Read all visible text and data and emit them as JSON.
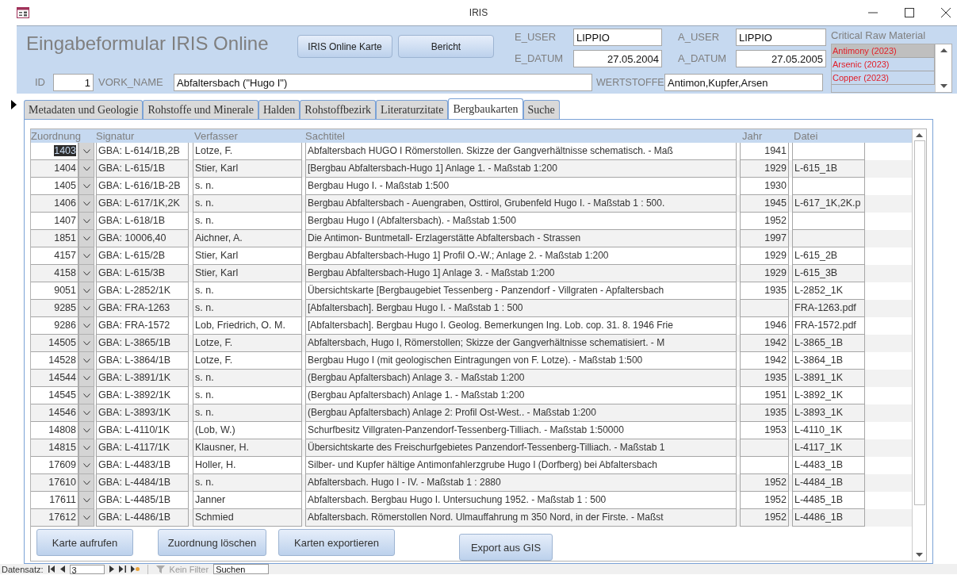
{
  "window": {
    "title": "IRIS"
  },
  "header": {
    "title": "Eingabeformular IRIS Online",
    "buttons": [
      "IRIS Online Karte",
      "Bericht"
    ],
    "fields": [
      {
        "label": "E_USER",
        "value": "LIPPIO",
        "kind": "text"
      },
      {
        "label": "A_USER",
        "value": "LIPPIO",
        "kind": "text"
      },
      {
        "label": "E_DATUM",
        "value": "27.05.2004",
        "kind": "date"
      },
      {
        "label": "A_DATUM",
        "value": "27.05.2005",
        "kind": "date"
      }
    ]
  },
  "record": {
    "id": {
      "label": "ID",
      "value": "1"
    },
    "vork_name": {
      "label": "VORK_NAME",
      "value": "Abfaltersbach (\"Hugo I\")"
    },
    "wertstoffe": {
      "label": "WERTSTOFFE",
      "value": "Antimon,Kupfer,Arsen"
    }
  },
  "critical_raw_material": {
    "label": "Critical Raw Material",
    "items": [
      {
        "name": "Antimony (2023)",
        "selected": true
      },
      {
        "name": "Arsenic (2023)",
        "selected": false
      },
      {
        "name": "Copper (2023)",
        "selected": false
      }
    ]
  },
  "tabs": [
    {
      "label": "Metadaten und Geologie",
      "selected": false
    },
    {
      "label": "Rohstoffe und Minerale",
      "selected": false
    },
    {
      "label": "Halden",
      "selected": false
    },
    {
      "label": "Rohstoffbezirk",
      "selected": false
    },
    {
      "label": "Literaturzitate",
      "selected": false
    },
    {
      "label": "Bergbaukarten",
      "selected": true
    },
    {
      "label": "Suche",
      "selected": false
    }
  ],
  "grid": {
    "columns": [
      "Zuordnung",
      "Signatur",
      "Verfasser",
      "Sachtitel",
      "Jahr",
      "Datei"
    ],
    "rows": [
      {
        "zuordnung": "1403",
        "signatur": "GBA: L-614/1B,2B",
        "verfasser": "Lotze, F.",
        "sachtitel": "Abfaltersbach HUGO I Römerstollen. Skizze der Gangverhältnisse schematisch. - Maß",
        "jahr": "1941",
        "selected": true
      },
      {
        "zuordnung": "1404",
        "signatur": "GBA: L-615/1B",
        "verfasser": "Stier, Karl",
        "sachtitel": "[Bergbau Abfaltersbach-Hugo 1] Anlage 1. - Maßstab 1:200",
        "jahr": "1929",
        "datei": "L-615_1B",
        "selected": false
      },
      {
        "zuordnung": "1405",
        "signatur": "GBA: L-616/1B-2B",
        "verfasser": "s. n.",
        "sachtitel": "Bergbau Hugo I. - Maßstab 1:500",
        "jahr": "1930",
        "selected": false
      },
      {
        "zuordnung": "1406",
        "signatur": "GBA: L-617/1K,2K",
        "verfasser": "s. n.",
        "sachtitel": "Bergbau Abfaltersbach - Auengraben, Osttirol, Grubenfeld Hugo I. - Maßstab 1 : 500.",
        "jahr": "1945",
        "datei": "L-617_1K,2K.p",
        "selected": false
      },
      {
        "zuordnung": "1407",
        "signatur": "GBA: L-618/1B",
        "verfasser": "s. n.",
        "sachtitel": "Bergbau Hugo I (Abfaltersbach). - Maßstab 1:500",
        "jahr": "1952",
        "selected": false
      },
      {
        "zuordnung": "1851",
        "signatur": "GBA: 10006,40",
        "verfasser": "Aichner, A.",
        "sachtitel": "Die Antimon- Buntmetall- Erzlagerstätte Abfaltersbach - Strassen",
        "jahr": "1997",
        "selected": false
      },
      {
        "zuordnung": "4157",
        "signatur": "GBA: L-615/2B",
        "verfasser": "Stier, Karl",
        "sachtitel": "Bergbau Abfaltersbach-Hugo 1] Profil O.-W.; Anlage 2. - Maßstab 1:200",
        "jahr": "1929",
        "datei": "L-615_2B",
        "selected": false
      },
      {
        "zuordnung": "4158",
        "signatur": "GBA: L-615/3B",
        "verfasser": "Stier, Karl",
        "sachtitel": "Bergbau Abfaltersbach-Hugo 1] Anlage 3. - Maßstab 1:200",
        "jahr": "1929",
        "datei": "L-615_3B",
        "selected": false
      },
      {
        "zuordnung": "9051",
        "signatur": "GBA: L-2852/1K",
        "verfasser": "s. n.",
        "sachtitel": "Übersichtskarte [Bergbaugebiet Tessenberg - Panzendorf - Villgraten - Apfaltersbach",
        "jahr": "1935",
        "datei": "L-2852_1K",
        "selected": false
      },
      {
        "zuordnung": "9285",
        "signatur": "GBA: FRA-1263",
        "verfasser": "s. n.",
        "sachtitel": "[Abfaltersbach]. Bergbau Hugo I. - Maßstab 1 : 500",
        "datei": "FRA-1263.pdf",
        "selected": false
      },
      {
        "zuordnung": "9286",
        "signatur": "GBA: FRA-1572",
        "verfasser": "Lob, Friedrich, O. M.",
        "sachtitel": "[Abfaltersbach]. Bergbau Hugo I. Geolog. Bemerkungen Ing. Lob. cop. 31. 8. 1946 Frie",
        "jahr": "1946",
        "datei": "FRA-1572.pdf",
        "selected": false
      },
      {
        "zuordnung": "14505",
        "signatur": "GBA: L-3865/1B",
        "verfasser": "Lotze, F.",
        "sachtitel": "Abfaltersbach, Hugo I, Römerstollen; Skizze der Gangverhältnisse schematisiert. - M",
        "jahr": "1942",
        "datei": "L-3865_1B",
        "selected": false
      },
      {
        "zuordnung": "14528",
        "signatur": "GBA: L-3864/1B",
        "verfasser": "Lotze, F.",
        "sachtitel": "Bergbau Hugo I (mit geologischen Eintragungen von F. Lotze). - Maßstab 1:500",
        "jahr": "1942",
        "datei": "L-3864_1B",
        "selected": false
      },
      {
        "zuordnung": "14544",
        "signatur": "GBA: L-3891/1K",
        "verfasser": "s. n.",
        "sachtitel": "(Bergbau Apfaltersbach) Anlage 3. - Maßstab 1:200",
        "jahr": "1935",
        "datei": "L-3891_1K",
        "selected": false
      },
      {
        "zuordnung": "14545",
        "signatur": "GBA: L-3892/1K",
        "verfasser": "s. n.",
        "sachtitel": "(Bergbau Apfaltersbach) Anlage 1. - Maßstab 1:200",
        "jahr": "1951",
        "datei": "L-3892_1K",
        "selected": false
      },
      {
        "zuordnung": "14546",
        "signatur": "GBA: L-3893/1K",
        "verfasser": "s. n.",
        "sachtitel": "(Bergbau Apfaltersbach) Anlage 2: Profil Ost-West.. - Maßstab 1:200",
        "jahr": "1935",
        "datei": "L-3893_1K",
        "selected": false
      },
      {
        "zuordnung": "14808",
        "signatur": "GBA: L-4110/1K",
        "verfasser": "(Lob, W.)",
        "sachtitel": "Schurfbesitz Villgraten-Panzendorf-Tessenberg-Tilliach. - Maßstab 1:50000",
        "jahr": "1953",
        "datei": "L-4110_1K",
        "selected": false
      },
      {
        "zuordnung": "14815",
        "signatur": "GBA: L-4117/1K",
        "verfasser": "Klausner, H.",
        "sachtitel": "Übersichtskarte des Freischurfgebietes Panzendorf-Tessenberg-Tilliach. - Maßstab 1",
        "datei": "L-4117_1K",
        "selected": false
      },
      {
        "zuordnung": "17609",
        "signatur": "GBA: L-4483/1B",
        "verfasser": "Holler, H.",
        "sachtitel": "Silber- und Kupfer hältige Antimonfahlerzgrube Hugo I (Dorfberg) bei Abfaltersbach",
        "datei": "L-4483_1B",
        "selected": false
      },
      {
        "zuordnung": "17610",
        "signatur": "GBA: L-4484/1B",
        "verfasser": "s. n.",
        "sachtitel": "Abfaltersbach. Hugo I - IV. - Maßstab 1 : 2880",
        "jahr": "1952",
        "datei": "L-4484_1B",
        "selected": false
      },
      {
        "zuordnung": "17611",
        "signatur": "GBA: L-4485/1B",
        "verfasser": "Janner",
        "sachtitel": "Abfaltersbach. Bergbau Hugo I. Untersuchung 1952. - Maßstab 1 : 500",
        "jahr": "1952",
        "datei": "L-4485_1B",
        "selected": false
      },
      {
        "zuordnung": "17612",
        "signatur": "GBA: L-4486/1B",
        "verfasser": "Schmied",
        "sachtitel": "Abfaltersbach. Römerstollen Nord. Ulmauffahrung m 350 Nord, in der Firste. - Maßst",
        "jahr": "1952",
        "datei": "L-4486_1B",
        "selected": false
      }
    ]
  },
  "buttons": [
    "Karte aufrufen",
    "Zuordnung löschen",
    "Karten exportieren",
    "Export aus GIS"
  ],
  "navigation": {
    "label": "Datensatz:",
    "record": "3",
    "filter": {
      "label": "Kein Filter",
      "disabled": true
    },
    "search": {
      "placeholder": "Suchen"
    }
  }
}
